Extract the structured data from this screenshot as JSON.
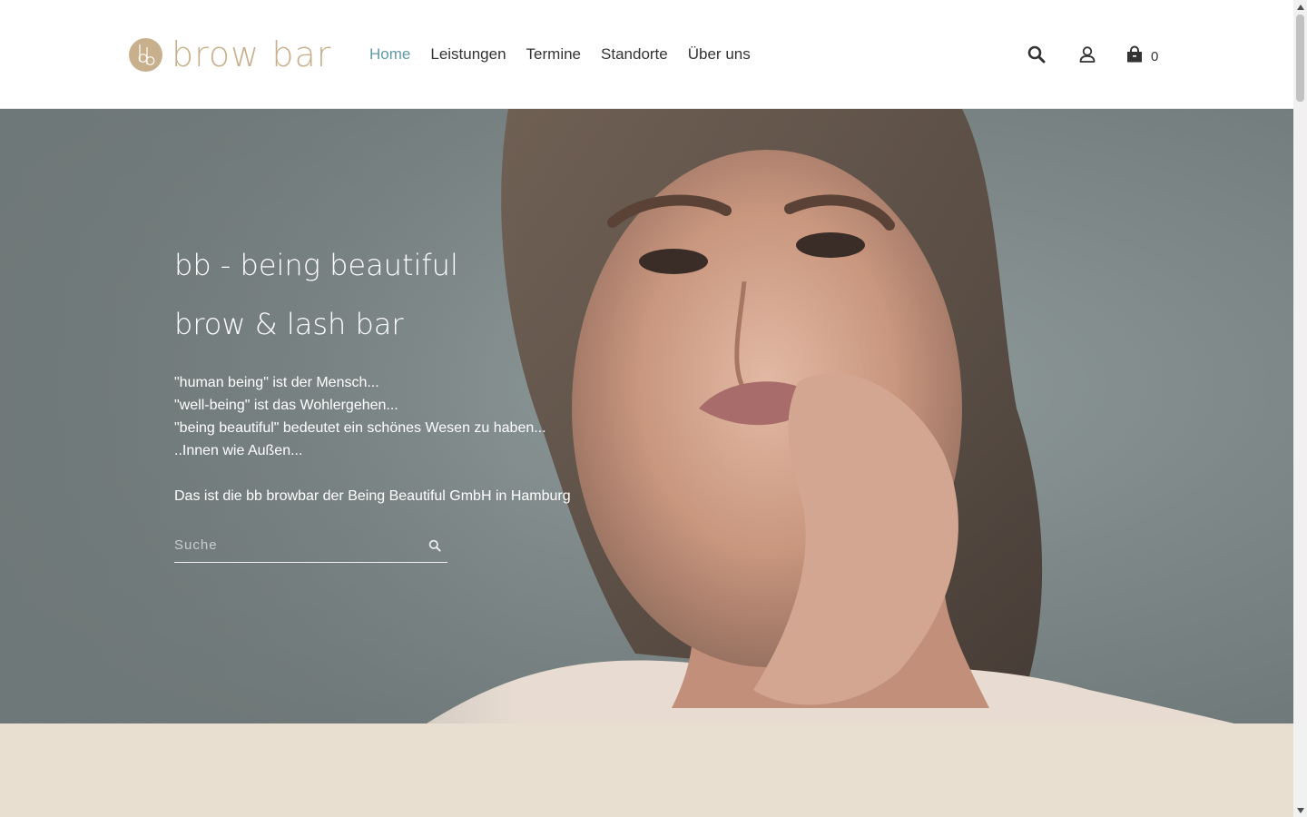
{
  "brand": {
    "logo_text": "brow bar",
    "logo_monogram": "bb",
    "logo_color": "#c9b08d"
  },
  "nav": {
    "items": [
      {
        "label": "Home",
        "active": true
      },
      {
        "label": "Leistungen",
        "active": false
      },
      {
        "label": "Termine",
        "active": false
      },
      {
        "label": "Standorte",
        "active": false
      },
      {
        "label": "Über uns",
        "active": false
      }
    ],
    "active_color": "#5f9aa5"
  },
  "header_icons": {
    "search": "search-icon",
    "account": "user-icon",
    "cart": "shopping-bag-icon",
    "cart_count": "0"
  },
  "hero": {
    "title": "bb - being beautiful",
    "subtitle": "brow & lash bar",
    "lines": [
      "\"human being\" ist der Mensch...",
      "\"well-being\" ist das Wohlergehen...",
      "\"being beautiful\" bedeutet ein schönes Wesen zu haben...",
      "..Innen wie Außen..."
    ],
    "tagline": "Das ist die bb browbar der Being Beautiful GmbH in Hamburg",
    "search": {
      "placeholder": "Suche",
      "value": ""
    }
  },
  "colors": {
    "beige_band": "#e9dfd0",
    "hero_background": "#7d8787"
  }
}
